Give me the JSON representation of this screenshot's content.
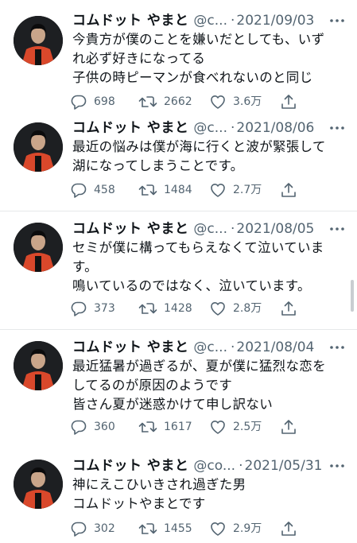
{
  "tweets": [
    {
      "name": "コムドット やまと",
      "handle": "@c...",
      "separator": "·",
      "date": "2021/09/03",
      "text": "今貴方が僕のことを嫌いだとしても、いずれ必ず好きになってる\n子供の時ピーマンが食べれないのと同じ",
      "replies": "698",
      "retweets": "2662",
      "likes": "3.6万"
    },
    {
      "name": "コムドット やまと",
      "handle": "@c...",
      "separator": "·",
      "date": "2021/08/06",
      "text": "最近の悩みは僕が海に行くと波が緊張して湖になってしまうことです。",
      "replies": "458",
      "retweets": "1484",
      "likes": "2.7万"
    },
    {
      "name": "コムドット やまと",
      "handle": "@c...",
      "separator": "·",
      "date": "2021/08/05",
      "text": "セミが僕に構ってもらえなくて泣いています。\n鳴いているのではなく、泣いています。",
      "replies": "373",
      "retweets": "1428",
      "likes": "2.8万"
    },
    {
      "name": "コムドット やまと",
      "handle": "@c...",
      "separator": "·",
      "date": "2021/08/04",
      "text": "最近猛暑が過ぎるが、夏が僕に猛烈な恋をしてるのが原因のようです\n皆さん夏が迷惑かけて申し訳ない",
      "replies": "360",
      "retweets": "1617",
      "likes": "2.5万"
    },
    {
      "name": "コムドット やまと",
      "handle": "@co...",
      "separator": "·",
      "date": "2021/05/31",
      "text": "神にえこひいきされ過ぎた男\nコムドットやまとです",
      "replies": "302",
      "retweets": "1455",
      "likes": "2.9万"
    }
  ],
  "icons": {
    "more": "more-horizontal-icon",
    "reply": "reply-bubble-icon",
    "retweet": "retweet-icon",
    "like": "heart-icon",
    "share": "share-upload-icon"
  },
  "colors": {
    "text": "#0f1419",
    "secondary": "#536471",
    "divider": "#e6e8ea",
    "jacket": "#d9482b"
  }
}
